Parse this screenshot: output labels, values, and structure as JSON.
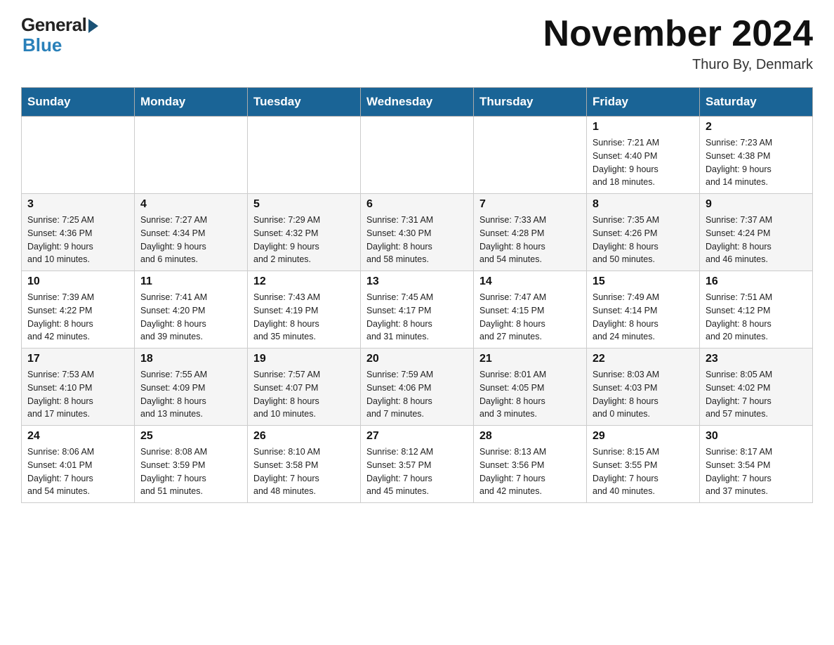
{
  "header": {
    "logo": {
      "general": "General",
      "blue": "Blue"
    },
    "title": "November 2024",
    "location": "Thuro By, Denmark"
  },
  "calendar": {
    "days_of_week": [
      "Sunday",
      "Monday",
      "Tuesday",
      "Wednesday",
      "Thursday",
      "Friday",
      "Saturday"
    ],
    "weeks": [
      [
        {
          "day": "",
          "info": ""
        },
        {
          "day": "",
          "info": ""
        },
        {
          "day": "",
          "info": ""
        },
        {
          "day": "",
          "info": ""
        },
        {
          "day": "",
          "info": ""
        },
        {
          "day": "1",
          "info": "Sunrise: 7:21 AM\nSunset: 4:40 PM\nDaylight: 9 hours\nand 18 minutes."
        },
        {
          "day": "2",
          "info": "Sunrise: 7:23 AM\nSunset: 4:38 PM\nDaylight: 9 hours\nand 14 minutes."
        }
      ],
      [
        {
          "day": "3",
          "info": "Sunrise: 7:25 AM\nSunset: 4:36 PM\nDaylight: 9 hours\nand 10 minutes."
        },
        {
          "day": "4",
          "info": "Sunrise: 7:27 AM\nSunset: 4:34 PM\nDaylight: 9 hours\nand 6 minutes."
        },
        {
          "day": "5",
          "info": "Sunrise: 7:29 AM\nSunset: 4:32 PM\nDaylight: 9 hours\nand 2 minutes."
        },
        {
          "day": "6",
          "info": "Sunrise: 7:31 AM\nSunset: 4:30 PM\nDaylight: 8 hours\nand 58 minutes."
        },
        {
          "day": "7",
          "info": "Sunrise: 7:33 AM\nSunset: 4:28 PM\nDaylight: 8 hours\nand 54 minutes."
        },
        {
          "day": "8",
          "info": "Sunrise: 7:35 AM\nSunset: 4:26 PM\nDaylight: 8 hours\nand 50 minutes."
        },
        {
          "day": "9",
          "info": "Sunrise: 7:37 AM\nSunset: 4:24 PM\nDaylight: 8 hours\nand 46 minutes."
        }
      ],
      [
        {
          "day": "10",
          "info": "Sunrise: 7:39 AM\nSunset: 4:22 PM\nDaylight: 8 hours\nand 42 minutes."
        },
        {
          "day": "11",
          "info": "Sunrise: 7:41 AM\nSunset: 4:20 PM\nDaylight: 8 hours\nand 39 minutes."
        },
        {
          "day": "12",
          "info": "Sunrise: 7:43 AM\nSunset: 4:19 PM\nDaylight: 8 hours\nand 35 minutes."
        },
        {
          "day": "13",
          "info": "Sunrise: 7:45 AM\nSunset: 4:17 PM\nDaylight: 8 hours\nand 31 minutes."
        },
        {
          "day": "14",
          "info": "Sunrise: 7:47 AM\nSunset: 4:15 PM\nDaylight: 8 hours\nand 27 minutes."
        },
        {
          "day": "15",
          "info": "Sunrise: 7:49 AM\nSunset: 4:14 PM\nDaylight: 8 hours\nand 24 minutes."
        },
        {
          "day": "16",
          "info": "Sunrise: 7:51 AM\nSunset: 4:12 PM\nDaylight: 8 hours\nand 20 minutes."
        }
      ],
      [
        {
          "day": "17",
          "info": "Sunrise: 7:53 AM\nSunset: 4:10 PM\nDaylight: 8 hours\nand 17 minutes."
        },
        {
          "day": "18",
          "info": "Sunrise: 7:55 AM\nSunset: 4:09 PM\nDaylight: 8 hours\nand 13 minutes."
        },
        {
          "day": "19",
          "info": "Sunrise: 7:57 AM\nSunset: 4:07 PM\nDaylight: 8 hours\nand 10 minutes."
        },
        {
          "day": "20",
          "info": "Sunrise: 7:59 AM\nSunset: 4:06 PM\nDaylight: 8 hours\nand 7 minutes."
        },
        {
          "day": "21",
          "info": "Sunrise: 8:01 AM\nSunset: 4:05 PM\nDaylight: 8 hours\nand 3 minutes."
        },
        {
          "day": "22",
          "info": "Sunrise: 8:03 AM\nSunset: 4:03 PM\nDaylight: 8 hours\nand 0 minutes."
        },
        {
          "day": "23",
          "info": "Sunrise: 8:05 AM\nSunset: 4:02 PM\nDaylight: 7 hours\nand 57 minutes."
        }
      ],
      [
        {
          "day": "24",
          "info": "Sunrise: 8:06 AM\nSunset: 4:01 PM\nDaylight: 7 hours\nand 54 minutes."
        },
        {
          "day": "25",
          "info": "Sunrise: 8:08 AM\nSunset: 3:59 PM\nDaylight: 7 hours\nand 51 minutes."
        },
        {
          "day": "26",
          "info": "Sunrise: 8:10 AM\nSunset: 3:58 PM\nDaylight: 7 hours\nand 48 minutes."
        },
        {
          "day": "27",
          "info": "Sunrise: 8:12 AM\nSunset: 3:57 PM\nDaylight: 7 hours\nand 45 minutes."
        },
        {
          "day": "28",
          "info": "Sunrise: 8:13 AM\nSunset: 3:56 PM\nDaylight: 7 hours\nand 42 minutes."
        },
        {
          "day": "29",
          "info": "Sunrise: 8:15 AM\nSunset: 3:55 PM\nDaylight: 7 hours\nand 40 minutes."
        },
        {
          "day": "30",
          "info": "Sunrise: 8:17 AM\nSunset: 3:54 PM\nDaylight: 7 hours\nand 37 minutes."
        }
      ]
    ]
  }
}
